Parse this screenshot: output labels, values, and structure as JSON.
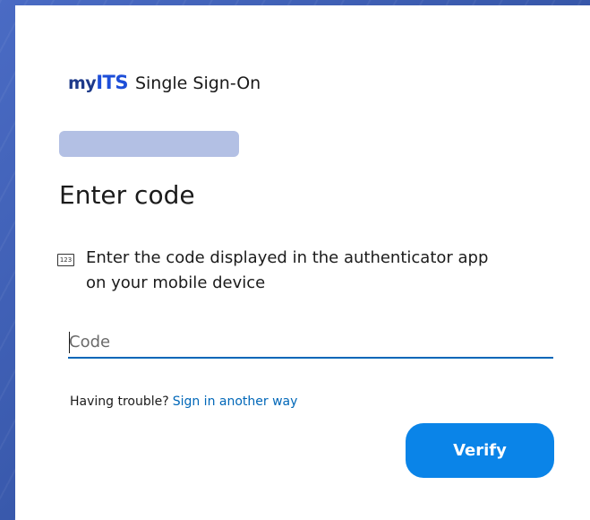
{
  "brand": {
    "logo": "myITS",
    "title": "Single Sign-On"
  },
  "form": {
    "heading": "Enter code",
    "icon_text": "123",
    "instruction": "Enter the code displayed in the authenticator app on your mobile device",
    "code_placeholder": "Code",
    "code_value": ""
  },
  "help": {
    "prompt": "Having trouble?",
    "link": "Sign in another way"
  },
  "actions": {
    "verify_label": "Verify"
  },
  "colors": {
    "background": "#3b5bb0",
    "accent": "#0067b8",
    "button": "#0a84e8",
    "account_placeholder": "#b3c0e4"
  },
  "icons": {
    "instruction_icon": "numeric-code-icon"
  }
}
